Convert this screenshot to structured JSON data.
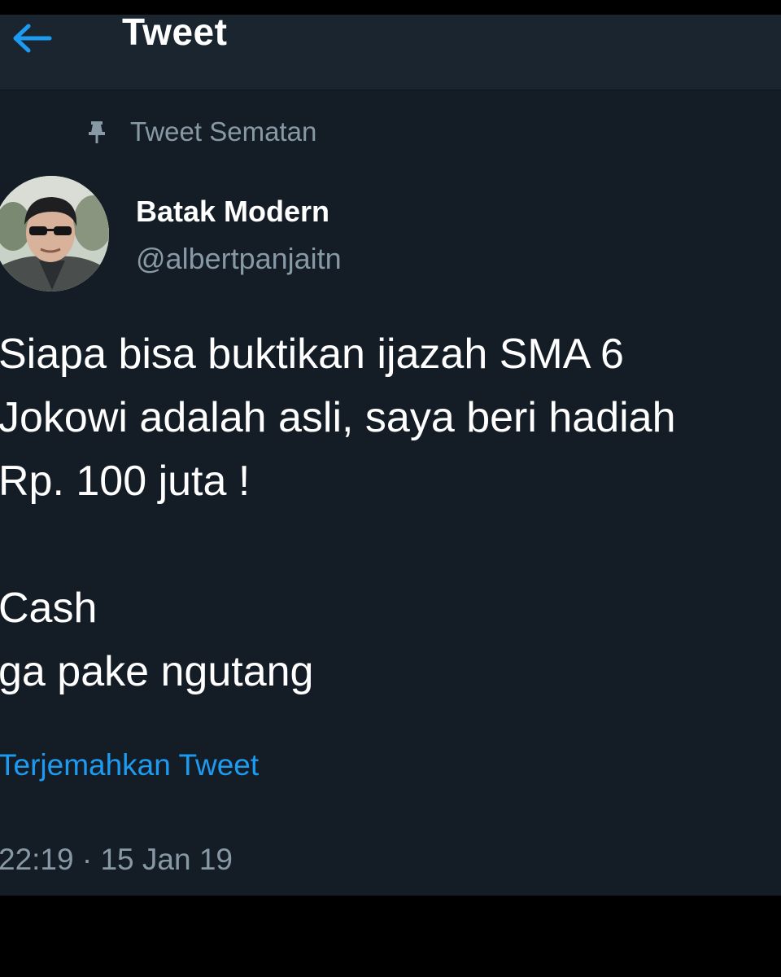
{
  "header": {
    "title": "Tweet",
    "back_icon": "arrow-left-icon",
    "accent_color": "#1d9bf0"
  },
  "pinned": {
    "icon": "pin-icon",
    "label": "Tweet Sematan"
  },
  "author": {
    "name": "Batak Modern",
    "handle": "@albertpanjaitn",
    "avatar_icon": "avatar-photo"
  },
  "tweet": {
    "text": "Siapa bisa buktikan ijazah SMA 6\nJokowi adalah asli, saya beri hadiah\nRp. 100 juta !\n\nCash\nga pake ngutang",
    "translate_label": "Terjemahkan Tweet",
    "timestamp": "22:19 · 15 Jan 19"
  },
  "colors": {
    "background": "#141d26",
    "header_background": "#1a2530",
    "secondary_text": "#8899a6",
    "primary_text": "#ffffff",
    "link": "#1d9bf0"
  }
}
